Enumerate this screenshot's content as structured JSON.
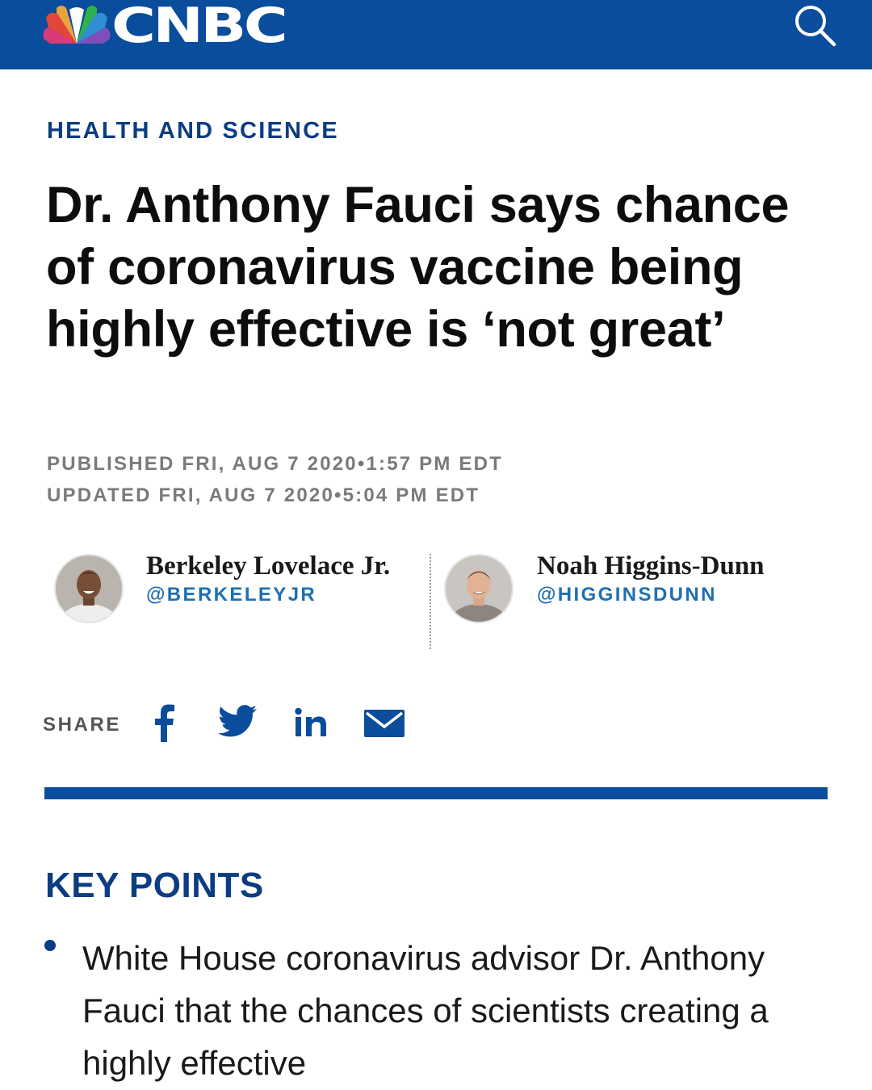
{
  "header": {
    "logo_text": "CNBC",
    "logo_icon": "nbc-peacock-icon",
    "search_icon": "search-icon",
    "brand_color": "#0a4d9c"
  },
  "article": {
    "section": "HEALTH AND SCIENCE",
    "headline": "Dr. Anthony Fauci says chance of coronavirus vaccine being highly effective is ‘not great’",
    "published": "PUBLISHED FRI, AUG 7 2020•1:57 PM EDT",
    "updated": "UPDATED FRI, AUG 7 2020•5:04 PM EDT"
  },
  "authors": [
    {
      "name": "Berkeley Lovelace Jr.",
      "handle": "@BERKELEYJR"
    },
    {
      "name": "Noah Higgins-Dunn",
      "handle": "@HIGGINSDUNN"
    }
  ],
  "share": {
    "label": "SHARE",
    "icons": [
      "facebook-icon",
      "twitter-icon",
      "linkedin-icon",
      "email-icon"
    ]
  },
  "key_points": {
    "heading": "KEY POINTS",
    "items": [
      "White House coronavirus advisor Dr. Anthony Fauci that the chances of scientists creating a highly effective"
    ]
  }
}
